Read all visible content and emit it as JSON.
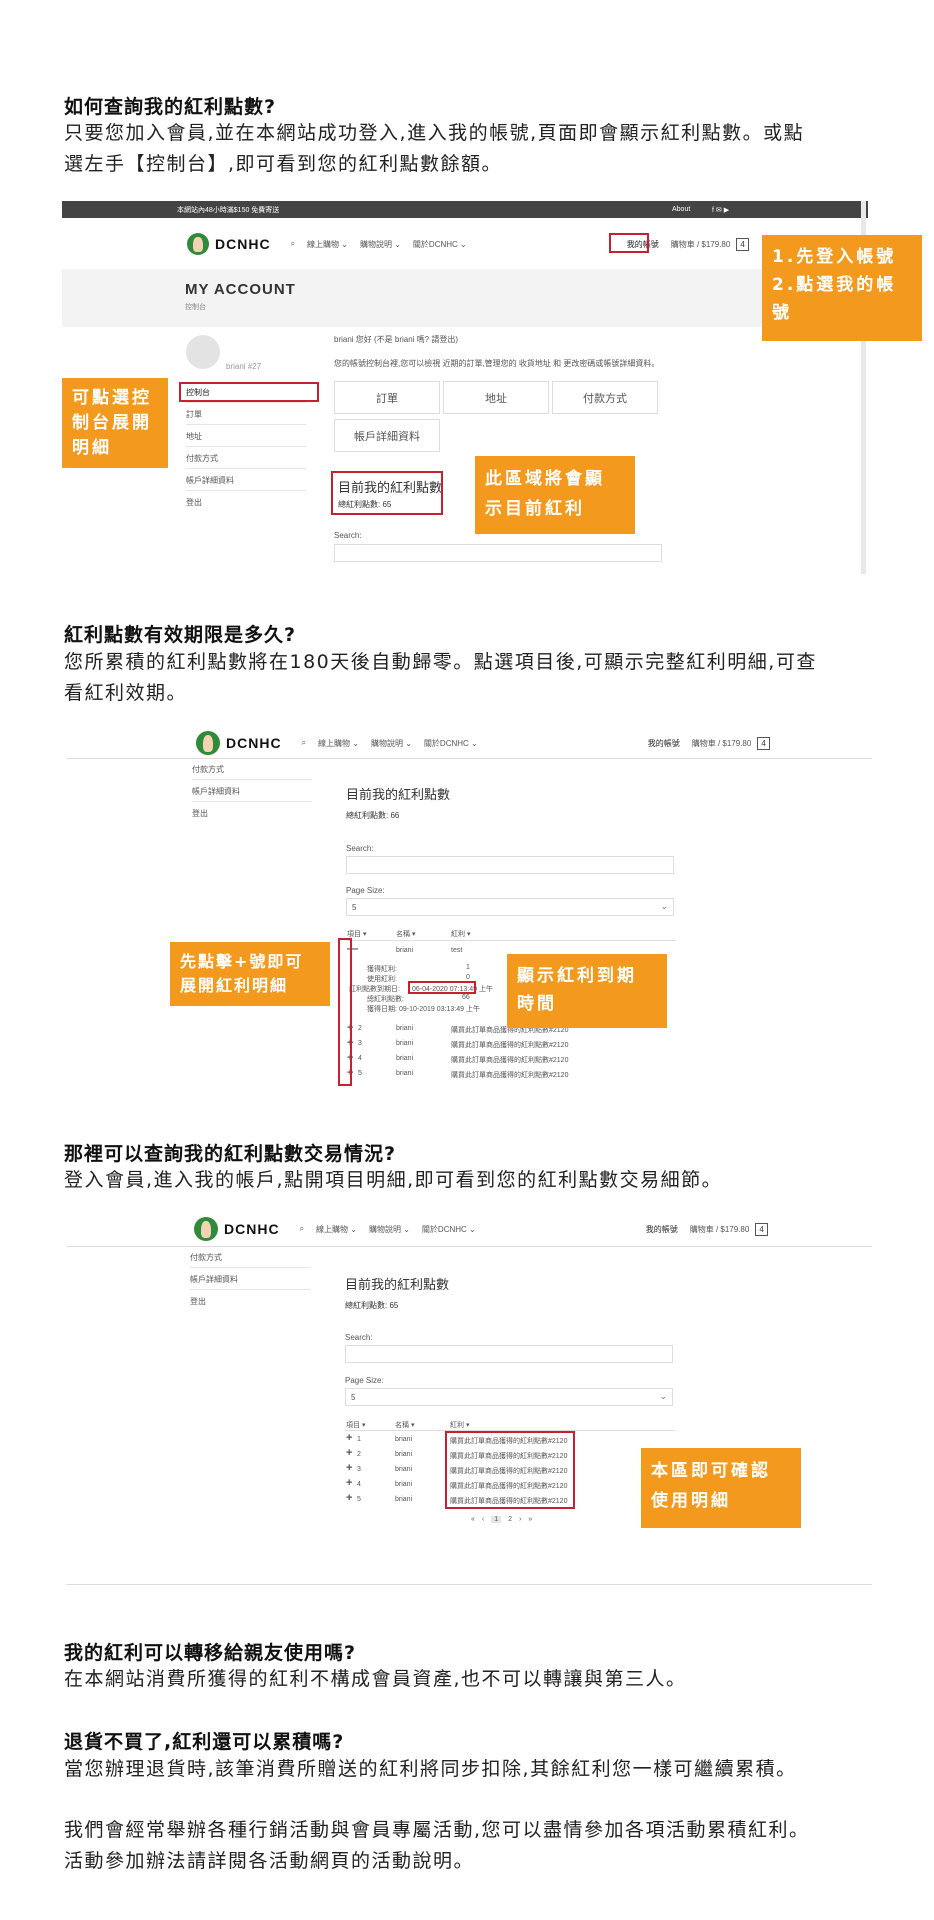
{
  "section1": {
    "question": "如何查詢我的紅利點數?",
    "answer_line1": "只要您加入會員,並在本網站成功登入,進入我的帳號,頁面即會顯示紅利點數。或點",
    "answer_line2": "選左手【控制台】,即可看到您的紅利點數餘額。"
  },
  "screenshot1": {
    "topbar_text": "本網站內48小時滿$150 免費寄送",
    "topbar_about": "About",
    "topbar_icons": "f ✉ ▶",
    "logo": "DCNHC",
    "nav": [
      "線上購物 ⌄",
      "購物說明 ⌄",
      "關於DCNHC ⌄"
    ],
    "my_account_link": "我的帳號",
    "cart": "購物車 / $179.80",
    "cart_count": "4",
    "page_title": "MY ACCOUNT",
    "breadcrumb": "控制台",
    "username": "briani #27",
    "sidebar": [
      "控制台",
      "訂單",
      "地址",
      "付款方式",
      "帳戶詳細資料",
      "登出"
    ],
    "greeting": "briani 您好 (不是 briani 嗎? 請登出)",
    "intro": "您的帳號控制台裡,您可以檢視 近期的訂單,管理您的 收貨地址 和 更改密碼或帳號詳細資料。",
    "buttons": [
      "訂單",
      "地址",
      "付款方式",
      "帳戶詳細資料"
    ],
    "points_heading": "目前我的紅利點數",
    "points_total": "總紅利點數: 65",
    "search_label": "Search:",
    "callout_login": [
      "1.先登入帳號",
      "2.點選我的帳號"
    ],
    "callout_sidebar": [
      "可點選控",
      "制台展開",
      "明細"
    ],
    "callout_points": [
      "此區域將會顯",
      "示目前紅利"
    ]
  },
  "section2": {
    "question": "紅利點數有效期限是多久?",
    "answer_line1": "您所累積的紅利點數將在180天後自動歸零。點選項目後,可顯示完整紅利明細,可查",
    "answer_line2": "看紅利效期。"
  },
  "screenshot2": {
    "logo": "DCNHC",
    "nav": [
      "線上購物 ⌄",
      "購物說明 ⌄",
      "關於DCNHC ⌄"
    ],
    "my_account_link": "我的帳號",
    "cart": "購物車 / $179.80",
    "cart_count": "4",
    "sidebar": [
      "付款方式",
      "帳戶詳細資料",
      "登出"
    ],
    "points_heading": "目前我的紅利點數",
    "points_total": "總紅利點數: 66",
    "search_label": "Search:",
    "page_size_label": "Page Size:",
    "page_size_value": "5",
    "columns": [
      "項目 ▾",
      "名稱 ▾",
      "紅利 ▾"
    ],
    "expanded_name": "briani",
    "expanded_value": "test",
    "detail_rows": [
      {
        "label": "獲得紅利:",
        "value": "1"
      },
      {
        "label": "使用紅利:",
        "value": "0"
      },
      {
        "label": "紅利點數到期日:",
        "value": "06-04-2020 07:13:49 上午"
      },
      {
        "label": "總紅利點數:",
        "value": "66"
      },
      {
        "label": "獲得日期:",
        "value": "09-10-2019 03:13:49 上午"
      }
    ],
    "rows": [
      {
        "num": "2",
        "name": "briani",
        "desc": "購買此訂單商品獲得的紅利點數#2120"
      },
      {
        "num": "3",
        "name": "briani",
        "desc": "購買此訂單商品獲得的紅利點數#2120"
      },
      {
        "num": "4",
        "name": "briani",
        "desc": "購買此訂單商品獲得的紅利點數#2120"
      },
      {
        "num": "5",
        "name": "briani",
        "desc": "購買此訂單商品獲得的紅利點數#2120"
      }
    ],
    "callout_plus": [
      "先點擊+號即可",
      "展開紅利明細"
    ],
    "callout_expiry": [
      "顯示紅利到期",
      "時間"
    ]
  },
  "section3": {
    "question": "那裡可以查詢我的紅利點數交易情況?",
    "answer_line1": "登入會員,進入我的帳戶,點開項目明細,即可看到您的紅利點數交易細節。"
  },
  "screenshot3": {
    "logo": "DCNHC",
    "nav": [
      "線上購物 ⌄",
      "購物說明 ⌄",
      "關於DCNHC ⌄"
    ],
    "my_account_link": "我的帳號",
    "cart": "購物車 / $179.80",
    "cart_count": "4",
    "sidebar": [
      "付款方式",
      "帳戶詳細資料",
      "登出"
    ],
    "points_heading": "目前我的紅利點數",
    "points_total": "總紅利點數: 65",
    "search_label": "Search:",
    "page_size_label": "Page Size:",
    "page_size_value": "5",
    "columns": [
      "項目 ▾",
      "名稱 ▾",
      "紅利 ▾"
    ],
    "rows": [
      {
        "num": "1",
        "name": "briani",
        "desc": "購買此訂單商品獲得的紅利點數#2120"
      },
      {
        "num": "2",
        "name": "briani",
        "desc": "購買此訂單商品獲得的紅利點數#2120"
      },
      {
        "num": "3",
        "name": "briani",
        "desc": "購買此訂單商品獲得的紅利點數#2120"
      },
      {
        "num": "4",
        "name": "briani",
        "desc": "購買此訂單商品獲得的紅利點數#2120"
      },
      {
        "num": "5",
        "name": "briani",
        "desc": "購買此訂單商品獲得的紅利點數#2120"
      }
    ],
    "pagination": [
      "«",
      "‹",
      "1",
      "2",
      "›",
      "»"
    ],
    "callout_detail": [
      "本區即可確認",
      "使用明細"
    ]
  },
  "section4": {
    "question": "我的紅利可以轉移給親友使用嗎?",
    "answer_line1": "在本網站消費所獲得的紅利不構成會員資產,也不可以轉讓與第三人。"
  },
  "section5": {
    "question": "退貨不買了,紅利還可以累積嗎?",
    "answer_line1": "當您辦理退貨時,該筆消費所贈送的紅利將同步扣除,其餘紅利您一樣可繼續累積。"
  },
  "section6": {
    "answer_line1": "我們會經常舉辦各種行銷活動與會員專屬活動,您可以盡情參加各項活動累積紅利。",
    "answer_line2": "活動參加辦法請詳閱各活動網頁的活動說明。"
  }
}
